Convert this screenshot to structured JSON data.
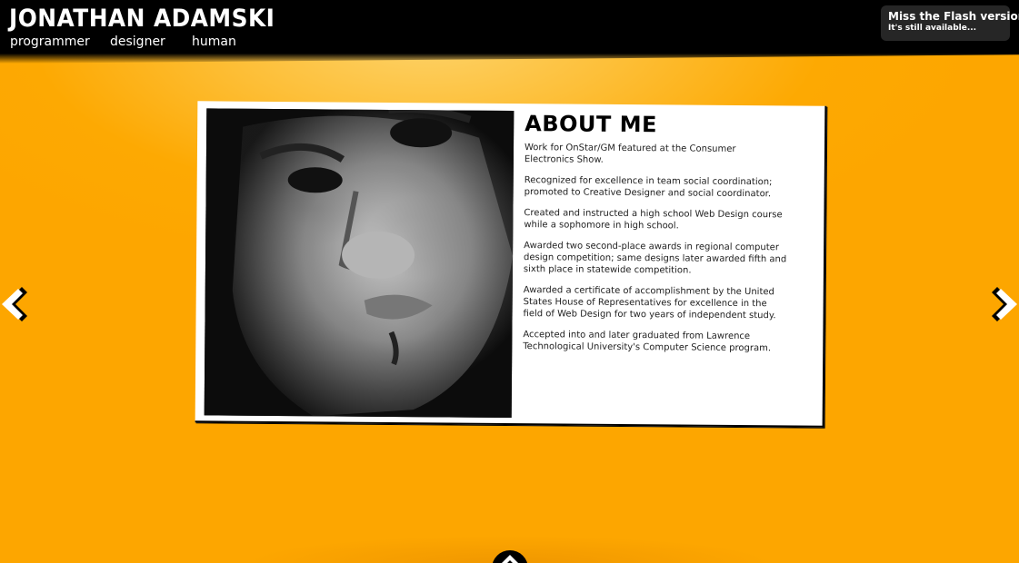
{
  "header": {
    "site_title": "JONATHAN ADAMSKI",
    "nav": [
      {
        "label": "programmer"
      },
      {
        "label": "designer"
      },
      {
        "label": "human"
      }
    ],
    "flash_notice": {
      "line1": "Miss the Flash version?",
      "line2": "It's still available..."
    }
  },
  "about": {
    "title": "ABOUT ME",
    "paragraphs": [
      "Work for OnStar/GM featured at the Consumer Electronics Show.",
      "Recognized for excellence in team social coordination; promoted to Creative Designer and social coordinator.",
      "Created and instructed a high school Web Design course while a sophomore in high school.",
      "Awarded two second-place awards in regional computer design competition; same designs later awarded fifth and sixth place in statewide competition.",
      "Awarded a certificate of accomplishment by the United States House of Representatives for excellence in the field of Web Design for two years of independent study.",
      "Accepted into and later graduated from Lawrence Technological University's Computer Science program."
    ]
  },
  "icons": {
    "prev": "chevron-left-icon",
    "next": "chevron-right-icon",
    "up": "chevron-up-icon"
  },
  "colors": {
    "background": "#fda600",
    "background_highlight": "#fdd36a",
    "header": "#000000",
    "flash_box": "#262626",
    "card": "#ffffff"
  }
}
